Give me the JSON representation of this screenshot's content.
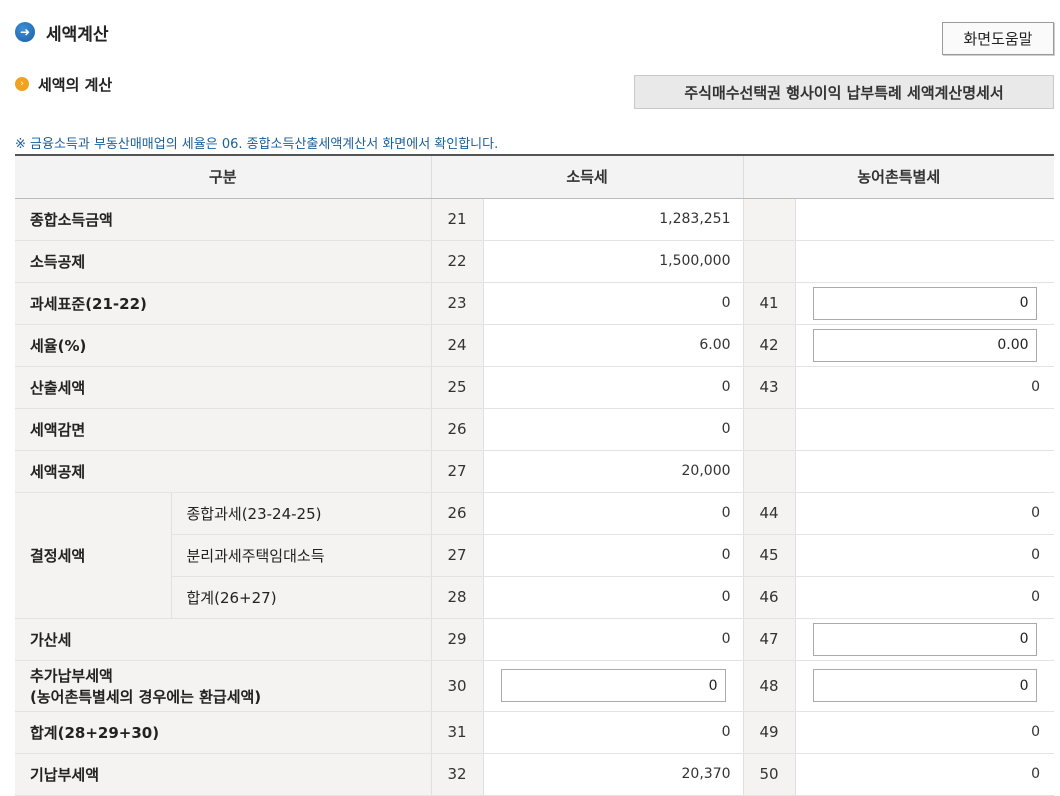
{
  "header": {
    "title": "세액계산",
    "help_label": "화면도움말"
  },
  "section": {
    "title": "세액의 계산",
    "statement_button": "주식매수선택권 행사이익 납부특례 세액계산명세서",
    "notice": "※ 금융소득과 부동산매매업의 세율은 06. 종합소득산출세액계산서 화면에서 확인합니다."
  },
  "table": {
    "headers": [
      "구분",
      "소득세",
      "농어촌특별세"
    ],
    "rows": [
      {
        "label": "종합소득금액",
        "num": "21",
        "value": "1,283,251"
      },
      {
        "label": "소득공제",
        "num": "22",
        "value": "1,500,000"
      },
      {
        "label": "과세표준(21-22)",
        "num": "23",
        "value": "0",
        "num2": "41",
        "value2": "0"
      },
      {
        "label": "세율(%)",
        "num": "24",
        "value": "6.00",
        "num2": "42",
        "value2": "0.00"
      },
      {
        "label": "산출세액",
        "num": "25",
        "value": "0",
        "num2": "43",
        "value2": "0"
      },
      {
        "label": "세액감면",
        "num": "26",
        "value": "0"
      },
      {
        "label": "세액공제",
        "num": "27",
        "value": "20,000"
      },
      {
        "group": "결정세액",
        "label": "종합과세(23-24-25)",
        "num": "26",
        "value": "0",
        "num2": "44",
        "value2": "0"
      },
      {
        "label": "분리과세주택임대소득",
        "num": "27",
        "value": "0",
        "num2": "45",
        "value2": "0"
      },
      {
        "label": "합계(26+27)",
        "num": "28",
        "value": "0",
        "num2": "46",
        "value2": "0"
      },
      {
        "label": "가산세",
        "num": "29",
        "value": "0",
        "num2": "47",
        "value2": "0"
      },
      {
        "label": "추가납부세액",
        "label_line2": "(농어촌특별세의 경우에는 환급세액)",
        "num": "30",
        "value": "0",
        "num2": "48",
        "value2": "0"
      },
      {
        "label": "합계(28+29+30)",
        "num": "31",
        "value": "0",
        "num2": "49",
        "value2": "0"
      },
      {
        "label": "기납부세액",
        "num": "32",
        "value": "20,370",
        "num2": "50",
        "value2": "0"
      }
    ]
  }
}
